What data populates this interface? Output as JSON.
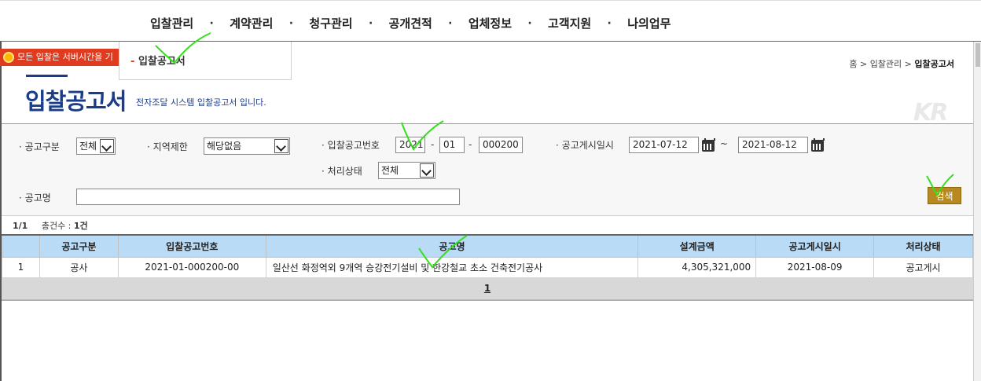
{
  "nav": {
    "items": [
      "입찰관리",
      "계약관리",
      "청구관리",
      "공개견적",
      "업체정보",
      "고객지원",
      "나의업무"
    ],
    "separator": "·"
  },
  "notice": {
    "text": "모든 입찰은 서버시간을 기"
  },
  "submenu": {
    "dash": "-",
    "item": "입찰공고서"
  },
  "breadcrumb": {
    "home": "홈",
    "sep": ">",
    "section": "입찰관리",
    "current": "입찰공고서"
  },
  "page": {
    "title": "입찰공고서",
    "description": "전자조달 시스템 입찰공고서 입니다.",
    "logo": "KR"
  },
  "search": {
    "bullet": "·",
    "category_label": "공고구분",
    "category_value": "전체",
    "region_label": "지역제한",
    "region_value": "해당없음",
    "bid_no_label": "입찰공고번호",
    "bid_no_year": "2021",
    "bid_no_mid": "01",
    "bid_no_seq": "000200",
    "bid_no_sep": "-",
    "date_label": "공고게시일시",
    "date_from": "2021-07-12",
    "date_tilde": "~",
    "date_to": "2021-08-12",
    "status_label": "처리상태",
    "status_value": "전체",
    "name_label": "공고명",
    "name_value": "",
    "button_label": "검색"
  },
  "result": {
    "page": "1/1",
    "total_label": "총건수 :",
    "total_count": "1건"
  },
  "table": {
    "columns": [
      "",
      "공고구분",
      "입찰공고번호",
      "공고명",
      "설계금액",
      "공고게시일시",
      "처리상태"
    ],
    "rows": [
      [
        "1",
        "공사",
        "2021-01-000200-00",
        "일산선 화정역외 9개역 승강전기설비 및 한강철교 초소 건축전기공사",
        "4,305,321,000",
        "2021-08-09",
        "공고게시"
      ]
    ]
  },
  "pager": {
    "current": "1"
  },
  "colors": {
    "accent": "#1a3c8b",
    "header_bg": "#b9dbf6",
    "notice_bg": "#e03b1e",
    "button_bg": "#b8891e",
    "check": "#33e01a"
  }
}
